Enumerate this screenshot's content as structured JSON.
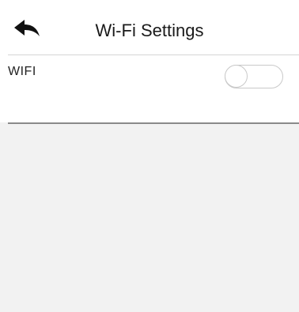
{
  "header": {
    "back_icon": "back-arrow-icon",
    "title": "Wi-Fi Settings"
  },
  "settings": {
    "wifi": {
      "label": "WIFI",
      "enabled": false
    }
  },
  "colors": {
    "background": "#f2f2f2",
    "panel": "#ffffff",
    "toggle_border": "#c9c9c9",
    "divider": "#8a8a8a",
    "text": "#1a1a1a"
  }
}
